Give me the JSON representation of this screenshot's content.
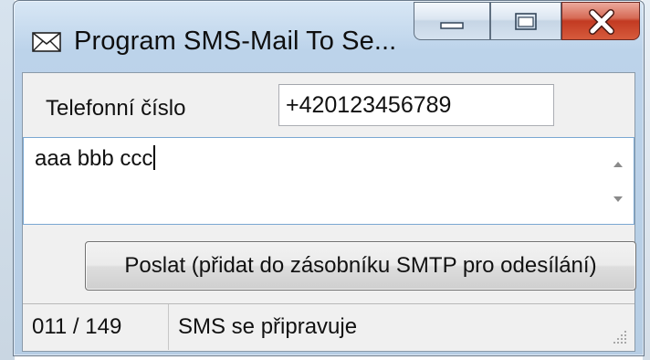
{
  "window": {
    "title": "Program SMS-Mail To Se...",
    "icons": {
      "app": "envelope-icon",
      "minimize": "minimize-icon",
      "maximize": "maximize-icon",
      "close": "close-icon"
    },
    "colors": {
      "close_button": "#c23a22",
      "focus_border": "#7aa7d2"
    }
  },
  "form": {
    "phone_label": "Telefonní číslo",
    "phone_value": "+420123456789",
    "message_text": "aaa bbb ccc",
    "send_label": "Poslat (přidat do zásobníku SMTP pro odesílání)"
  },
  "status": {
    "count": "011 / 149",
    "text": "SMS se připravuje"
  }
}
